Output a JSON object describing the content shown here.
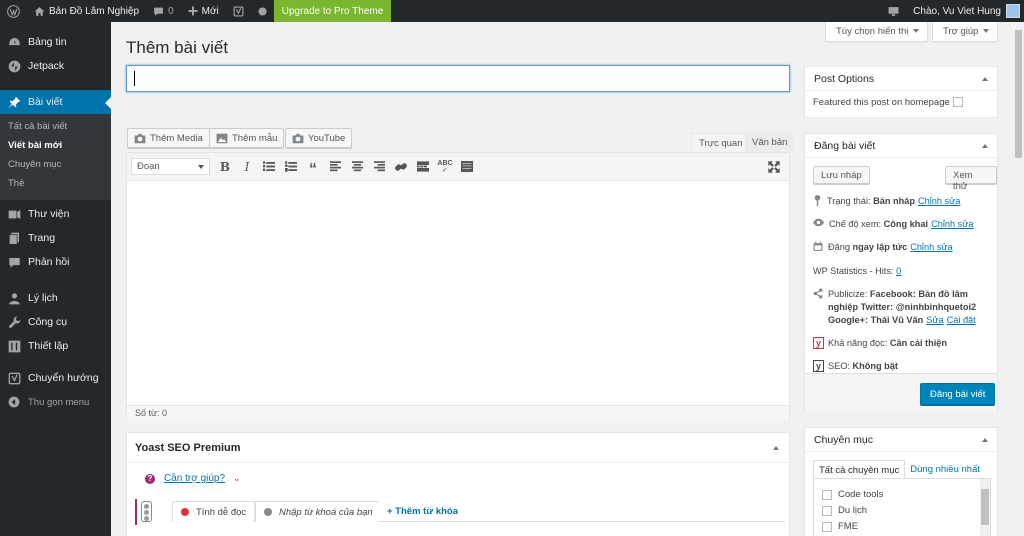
{
  "adminbar": {
    "site_name": "Bản Đồ Lâm Nghiệp",
    "comments_count": "0",
    "new_label": "Mới",
    "upgrade_label": "Upgrade to Pro Theme",
    "greeting": "Chào, Vu Viet Hung"
  },
  "sidebar": {
    "items": [
      {
        "label": "Bảng tin",
        "icon": "dashboard-icon"
      },
      {
        "label": "Jetpack",
        "icon": "jetpack-icon"
      },
      {
        "label": "Bài viết",
        "icon": "pin-icon"
      },
      {
        "label": "Thư viện",
        "icon": "media-icon"
      },
      {
        "label": "Trang",
        "icon": "page-icon"
      },
      {
        "label": "Phản hồi",
        "icon": "comment-icon"
      },
      {
        "label": "Lý lịch",
        "icon": "user-icon"
      },
      {
        "label": "Công cụ",
        "icon": "wrench-icon"
      },
      {
        "label": "Thiết lập",
        "icon": "settings-icon"
      },
      {
        "label": "Chuyển hướng",
        "icon": "yoast-icon"
      },
      {
        "label": "Thu gọn menu",
        "icon": "collapse-icon"
      }
    ],
    "submenu": [
      "Tất cả bài viết",
      "Viết bài mới",
      "Chuyên mục",
      "Thẻ"
    ]
  },
  "screen": {
    "options_label": "Tùy chọn hiển thị",
    "help_label": "Trợ giúp"
  },
  "page": {
    "title": "Thêm bài viết",
    "title_value": ""
  },
  "media_buttons": {
    "add_media": "Thêm Media",
    "add_template": "Thêm mẫu",
    "youtube": "YouTube"
  },
  "editor": {
    "tab_visual": "Trực quan",
    "tab_text": "Văn bản",
    "format_select": "Đoạn",
    "word_count": "Số từ: 0"
  },
  "yoast": {
    "title": "Yoast SEO Premium",
    "help_link": "Cần trợ giúp?",
    "tab_readability": "Tính dễ đọc",
    "tab_keyword": "Nhập từ khoá của bạn",
    "tab_add_keyword": "+ Thêm từ khóa",
    "colors": {
      "red": "#dc3232",
      "gray": "#888888",
      "purple": "#a4286a"
    }
  },
  "post_options": {
    "title": "Post Options",
    "featured_label": "Featured this post on homepage"
  },
  "publish": {
    "title": "Đăng bài viết",
    "save_draft": "Lưu nháp",
    "preview": "Xem thử",
    "status_label": "Trạng thái:",
    "status_value": "Bản nháp",
    "visibility_label": "Chế độ xem:",
    "visibility_value": "Công khai",
    "publish_label": "Đăng",
    "publish_value": "ngay lập tức",
    "edit_link": "Chỉnh sửa",
    "stats_label": "WP Statistics - Hits:",
    "stats_value": "0",
    "publicize_label": "Publicize:",
    "publicize_value": "Facebook: Bản đồ lâm nghiệp Twitter: @ninhbinhquetoi2 Google+: Thái Vũ Văn",
    "publicize_edit": "Sửa",
    "publicize_settings": "Cài đặt",
    "readability_label": "Khả năng đọc:",
    "readability_value": "Cần cải thiện",
    "seo_label": "SEO:",
    "seo_value": "Không bật",
    "publish_button": "Đăng bài viết"
  },
  "categories": {
    "title": "Chuyên mục",
    "tab_all": "Tất cả chuyên mục",
    "tab_popular": "Dùng nhiều nhất",
    "items": [
      "Code tools",
      "Du lịch",
      "FME"
    ]
  },
  "theme": {
    "accent": "#0073aa",
    "menu_bg": "#23282d",
    "upgrade_green": "#7ab62e"
  }
}
